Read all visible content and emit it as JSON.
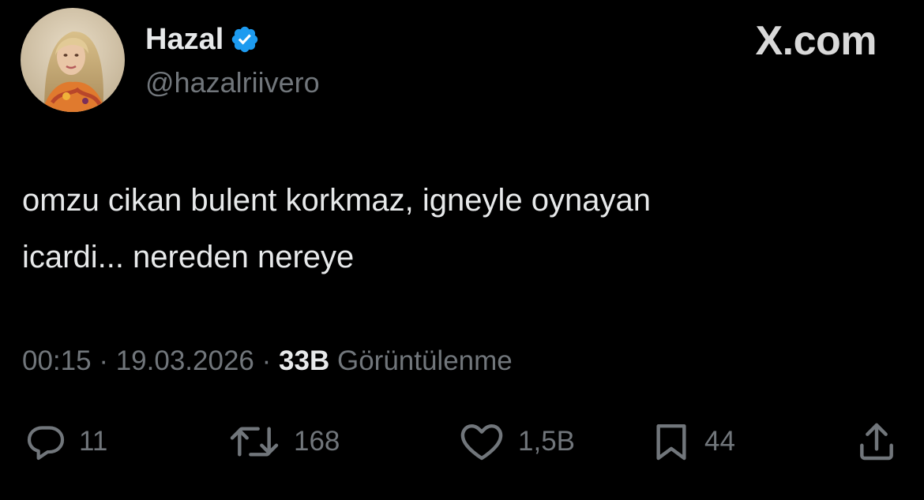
{
  "author": {
    "display_name": "Hazal",
    "handle": "@hazalriivero",
    "verified_color": "#1d9bf0"
  },
  "brand": {
    "label": "X.com"
  },
  "tweet": {
    "text": "omzu cikan bulent korkmaz, igneyle oynayan\nicardi... nereden nereye",
    "time": "00:15",
    "separator": "·",
    "date": "19.03.2026",
    "views_count": "33B",
    "views_label": "Görüntülenme"
  },
  "actions": {
    "replies": "11",
    "reposts": "168",
    "likes": "1,5B",
    "bookmarks": "44"
  },
  "icons": {
    "reply": "speech-bubble-icon",
    "repost": "repost-arrows-icon",
    "like": "heart-icon",
    "bookmark": "bookmark-icon",
    "share": "share-upload-icon",
    "verified": "verified-badge-icon"
  },
  "colors": {
    "background": "#000000",
    "primary_text": "#e7e9ea",
    "secondary_text": "#71767b",
    "accent": "#1d9bf0"
  }
}
